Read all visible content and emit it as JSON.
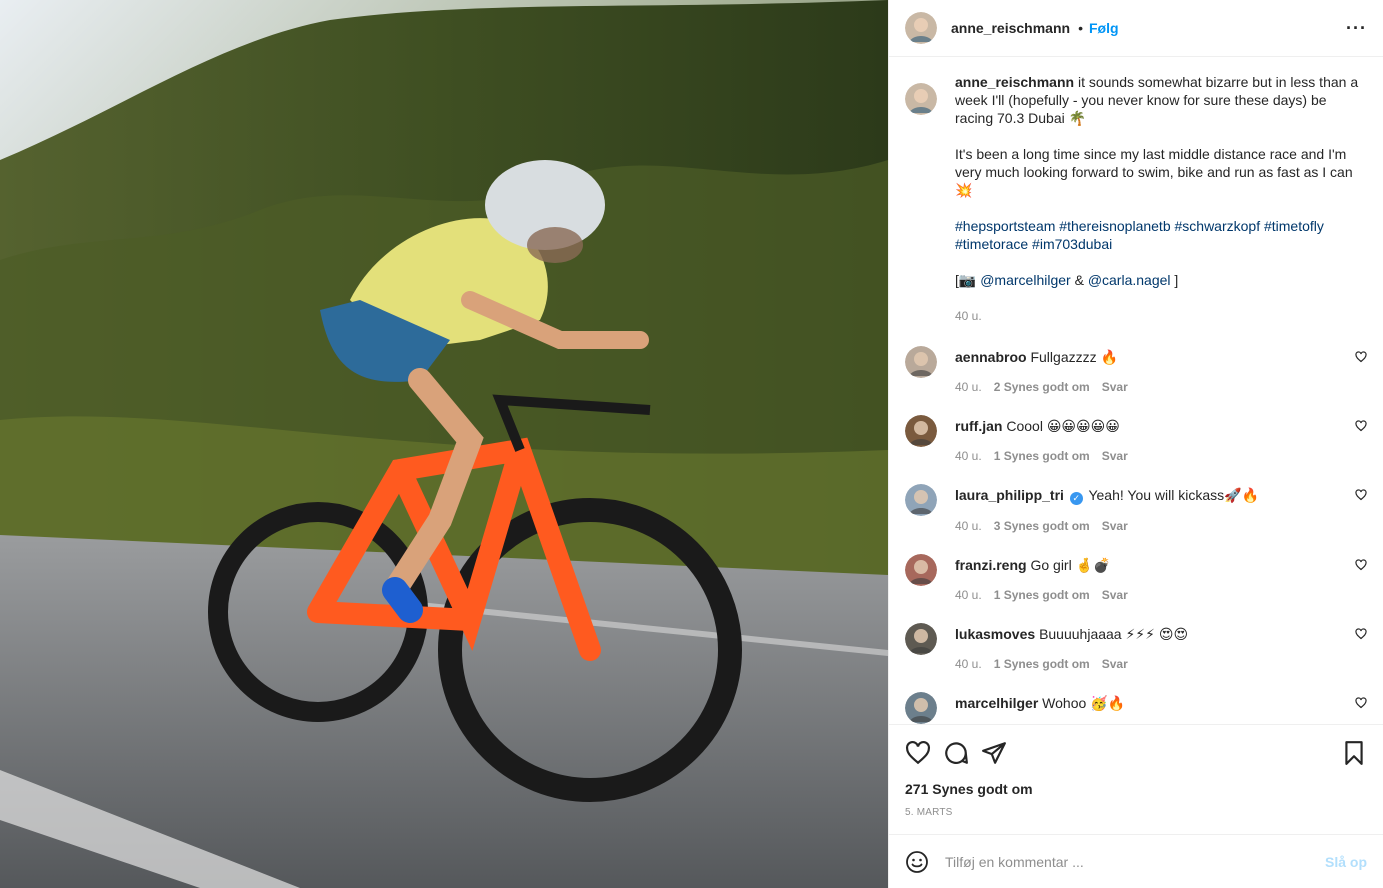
{
  "header": {
    "username": "anne_reischmann",
    "dot": "•",
    "follow_label": "Følg",
    "more_label": "···"
  },
  "caption": {
    "username": "anne_reischmann",
    "para1": "it sounds somewhat bizarre but in less than a week I'll (hopefully - you never know for sure these days) be racing 70.3 Dubai 🌴",
    "para2": "It's been a long time since my last middle distance race and I'm very much looking forward to swim, bike and run as fast as I can💥",
    "hashtags": [
      "#hepsportsteam",
      "#thereisnoplanetb",
      "#schwarzkopf",
      "#timetofly",
      "#timetorace",
      "#im703dubai"
    ],
    "credit_open": "[📷",
    "credit_user1": "@marcelhilger",
    "credit_amp": "&",
    "credit_user2": "@carla.nagel",
    "credit_close": "]",
    "time": "40 u."
  },
  "comments": [
    {
      "username": "aennabroo",
      "text": "Fullgazzzz 🔥",
      "time": "40 u.",
      "likes": "2 Synes godt om",
      "reply": "Svar",
      "verified": false,
      "avatar_color": "#b9a99a"
    },
    {
      "username": "ruff.jan",
      "text": "Coool 😀😀😀😀😀",
      "time": "40 u.",
      "likes": "1 Synes godt om",
      "reply": "Svar",
      "verified": false,
      "avatar_color": "#7a5a3e"
    },
    {
      "username": "laura_philipp_tri",
      "text": "Yeah! You will kickass🚀🔥",
      "time": "40 u.",
      "likes": "3 Synes godt om",
      "reply": "Svar",
      "verified": true,
      "verified_mark": "✓",
      "avatar_color": "#8fa4b8"
    },
    {
      "username": "franzi.reng",
      "text": "Go girl 🤞💣",
      "time": "40 u.",
      "likes": "1 Synes godt om",
      "reply": "Svar",
      "verified": false,
      "avatar_color": "#a7685c"
    },
    {
      "username": "lukasmoves",
      "text": "Buuuuhjaaaa ⚡⚡⚡ 😍😍",
      "time": "40 u.",
      "likes": "1 Synes godt om",
      "reply": "Svar",
      "verified": false,
      "avatar_color": "#5e5a52"
    },
    {
      "username": "marcelhilger",
      "text": "Wohoo 🥳🔥",
      "time": "",
      "likes": "",
      "reply": "",
      "verified": false,
      "avatar_color": "#6c7f8c"
    }
  ],
  "actions": {
    "icons": [
      "heart-icon",
      "comment-icon",
      "share-icon",
      "bookmark-icon"
    ],
    "likes": "271 Synes godt om",
    "date": "5. MARTS"
  },
  "add_comment": {
    "placeholder": "Tilføj en kommentar ...",
    "post_label": "Slå op"
  },
  "colors": {
    "link": "#0095f6",
    "hashtag": "#00376b",
    "muted": "#8e8e8e",
    "text": "#262626",
    "post_disabled": "#b2dffc"
  }
}
